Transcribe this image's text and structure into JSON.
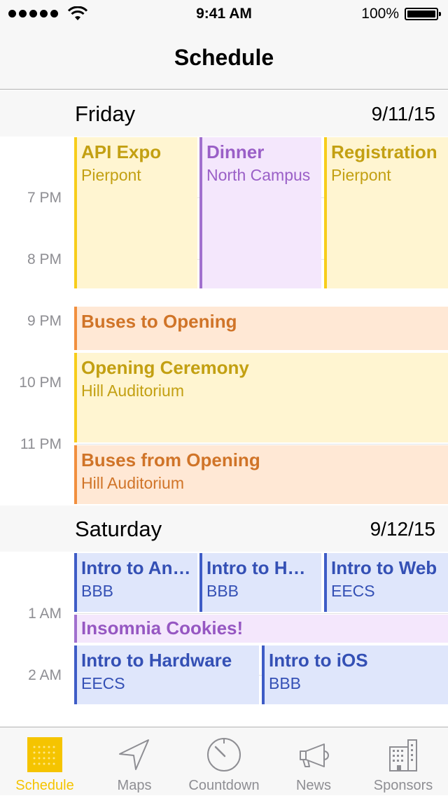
{
  "status_bar": {
    "time": "9:41 AM",
    "battery": "100%"
  },
  "nav": {
    "title": "Schedule"
  },
  "days": [
    {
      "name": "Friday",
      "date": "9/11/15",
      "time_labels": [
        "7 PM",
        "8 PM",
        "9 PM",
        "10 PM",
        "11 PM"
      ],
      "events": [
        {
          "title": "API Expo",
          "location": "Pierpont",
          "color": "yellow"
        },
        {
          "title": "Dinner",
          "location": "North Campus",
          "color": "purple"
        },
        {
          "title": "Registration",
          "location": "Pierpont",
          "color": "yellow"
        },
        {
          "title": "Buses to Opening",
          "location": "",
          "color": "orange"
        },
        {
          "title": "Opening Ceremony",
          "location": "Hill Auditorium",
          "color": "yellow"
        },
        {
          "title": "Buses from Opening",
          "location": "Hill Auditorium",
          "color": "orange"
        }
      ]
    },
    {
      "name": "Saturday",
      "date": "9/12/15",
      "time_labels": [
        "1 AM",
        "2 AM"
      ],
      "events": [
        {
          "title": "Intro to Android",
          "location": "BBB",
          "color": "blue"
        },
        {
          "title": "Intro to HTML",
          "location": "BBB",
          "color": "blue"
        },
        {
          "title": "Intro to Web",
          "location": "EECS",
          "color": "blue"
        },
        {
          "title": "Insomnia Cookies!",
          "location": "",
          "color": "lilac"
        },
        {
          "title": "Intro to Hardware",
          "location": "EECS",
          "color": "blue"
        },
        {
          "title": "Intro to iOS",
          "location": "BBB",
          "color": "blue"
        }
      ]
    }
  ],
  "tabs": [
    {
      "label": "Schedule",
      "icon": "calendar-grid-icon",
      "active": true
    },
    {
      "label": "Maps",
      "icon": "location-arrow-icon",
      "active": false
    },
    {
      "label": "Countdown",
      "icon": "timer-dial-icon",
      "active": false
    },
    {
      "label": "News",
      "icon": "megaphone-icon",
      "active": false
    },
    {
      "label": "Sponsors",
      "icon": "building-icon",
      "active": false
    }
  ],
  "colors": {
    "accent": "#f5c400",
    "yellow": "#f7cd1a",
    "purple": "#a170ce",
    "orange": "#f18f3e",
    "blue": "#3e5cc6"
  }
}
